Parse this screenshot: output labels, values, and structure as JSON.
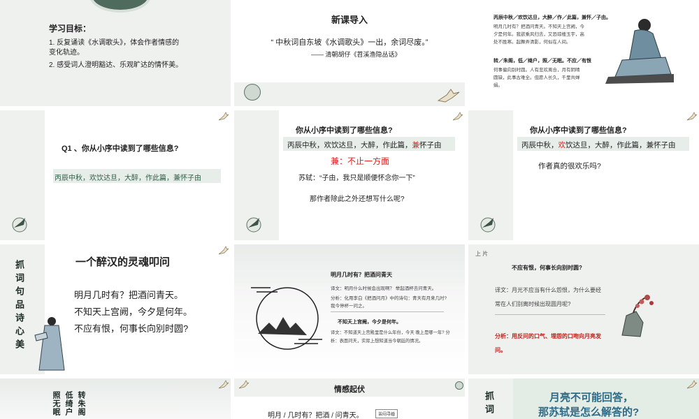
{
  "s1": {
    "heading": "学习目标：",
    "goal1": "1. 反复诵读《水调歌头》，体会作者情感的",
    "goal1b": "变化轨迹。",
    "goal2": "2. 感受词人澄明豁达、乐观旷达的情怀美。"
  },
  "s2": {
    "title": "新课导入",
    "quote": "“ 中秋词自东坡《水调歌头》一出，余词尽废。”",
    "source": "—— 清朝胡仔《苕溪渔隐丛话》"
  },
  "s3": {
    "p1_title": "丙辰中秋／欢饮达旦，大醉／作／此篇，兼怀／子由。",
    "p1_lines": [
      "明月几时有？把酒问青天。不知天上宫阙，今",
      "夕是何年。我欲乘风归去，又恐琼楼玉宇，高",
      "处不胜寒。起舞弄清影，何似在人间。"
    ],
    "p2_title": "转／朱阁，低／绮户，照／无眠。不应／有恨",
    "p2_lines": [
      "何事偏向别时圆。人有悲欢离合，月有阴晴",
      "圆缺，此事古难全。但愿人长久，千里共婵",
      "娟。"
    ]
  },
  "s4": {
    "question": "Q1 、你从小序中读到了哪些信息?",
    "answer": "丙辰中秋，欢饮达旦，大醉，作此篇，兼怀子由"
  },
  "s5": {
    "question": "你从小序中读到了哪些信息?",
    "answer_pre": "丙辰中秋，欢饮达旦，大醉，作此篇，",
    "answer_red": "兼",
    "answer_post": "怀子由",
    "note": "兼：不止一方面",
    "sushi": "苏轼：“子由，我只是顺便怀念你一下”",
    "follow": "那作者除此之外还想写什么呢?"
  },
  "s6": {
    "question": "你从小序中读到了哪些信息?",
    "answer_pre": "丙辰中秋，",
    "answer_red": "欢",
    "answer_post": "饮达旦，大醉，作此篇，兼怀子由",
    "follow": "作者真的很欢乐吗?"
  },
  "s7": {
    "side": "抓词句品诗心美",
    "title": "一个醉汉的灵魂叩问",
    "lines": [
      "明月几时有？把酒问青天。",
      "不知天上宫阙，今夕是何年。",
      "不应有恨，何事长向别时圆?"
    ]
  },
  "s8": {
    "q1": "明月几时有？把酒问青天",
    "t1": "译文：明月什么时候会出现啊？ 举起酒杯去问青天。",
    "a1": "分析：化用李白《把酒问月》中的诗句：青天有月来几时?",
    "a1b": "我今停杯一问之。",
    "q2": "不知天上宫阙，今夕是何年。",
    "t2": "译文：不知道天上宫殿里是什么年份，今天 晚上是哪一年? 分",
    "t2b": "析：表面问天，实际上想知道当今朝廷的情况。"
  },
  "s9": {
    "label": "上 片",
    "q": "不应有恨，何事长向别时圆?",
    "t": "译文：月光不应当有什么怨恨，为什么要经",
    "t2": "常在人们别离时候出现圆月呢?",
    "a": "分析：用反问的口气、埋怨的口吻向月亮发",
    "a2": "问。"
  },
  "s10": {
    "col1": "转朱阁",
    "col2": "低绮户",
    "col3": "照无眠"
  },
  "s11": {
    "title": "情感起伏",
    "line": "明月 / 几时有？把酒 / 问青天。",
    "box": "苦闷寻婚"
  },
  "s12": {
    "side": "抓词",
    "q1": "月亮不可能回答，",
    "q2": "那苏轼是怎么解答的?"
  }
}
